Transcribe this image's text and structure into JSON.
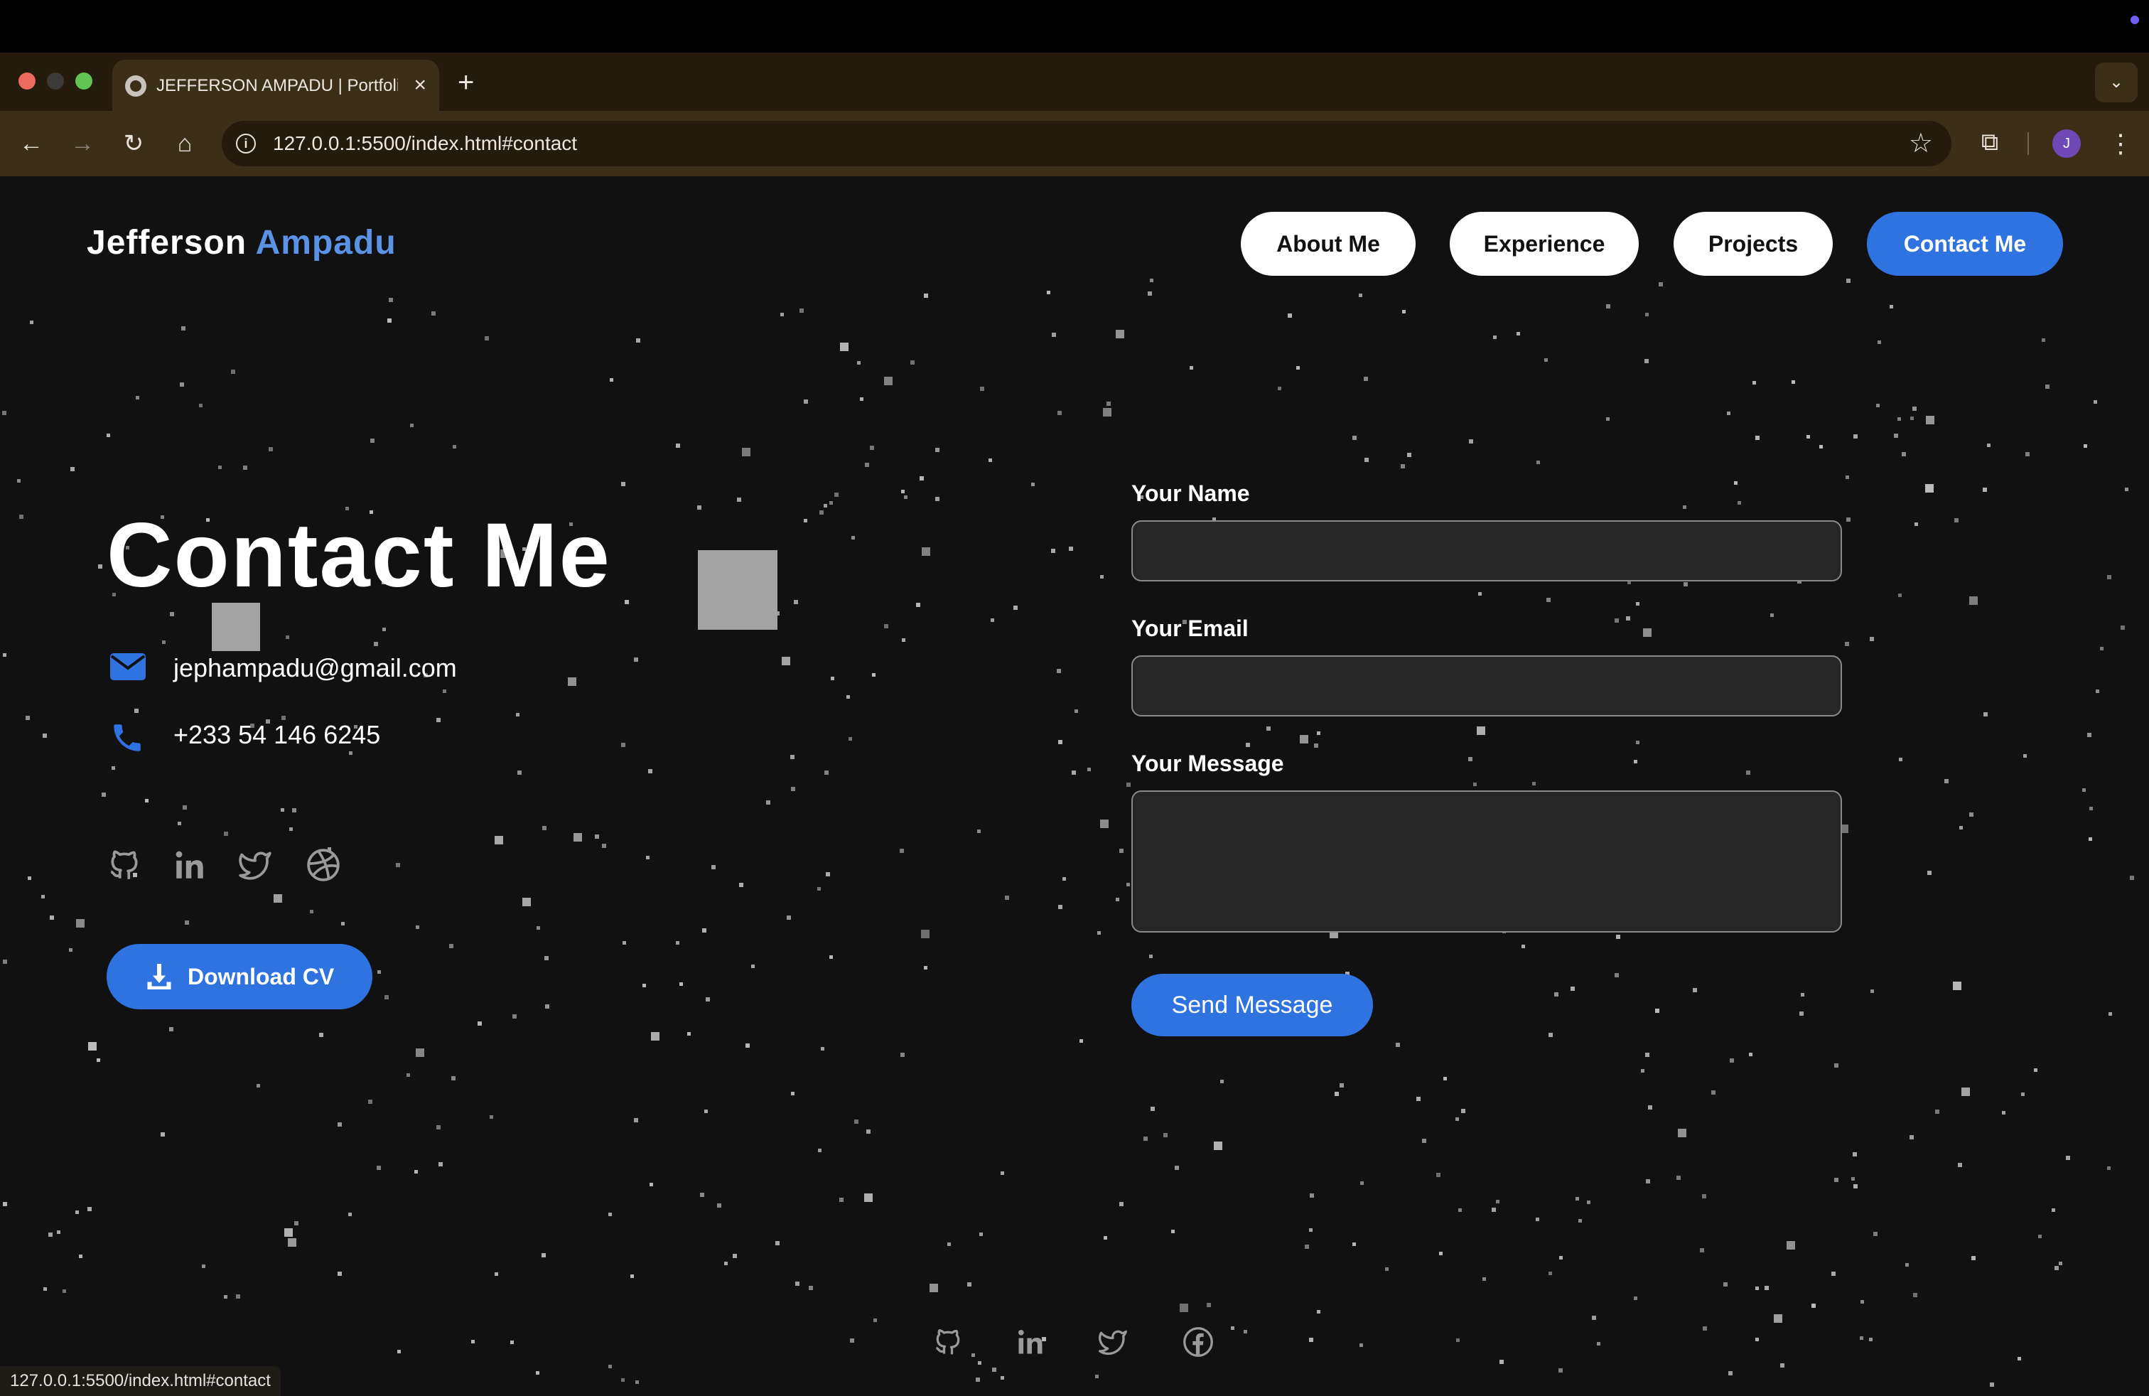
{
  "browser": {
    "tab_title": "JEFFERSON AMPADU | Portfolio",
    "tab_close": "×",
    "new_tab": "+",
    "tab_menu": "⌄",
    "url": "127.0.0.1:5500/index.html#contact",
    "profile_initial": "J",
    "status_url": "127.0.0.1:5500/index.html#contact",
    "icons": [
      "back-icon",
      "forward-icon",
      "reload-icon",
      "home-icon",
      "info-icon",
      "bookmark-star-icon",
      "extensions-icon",
      "menu-kebab-icon"
    ]
  },
  "header": {
    "logo_first": "Jefferson",
    "logo_last": "Ampadu",
    "nav": {
      "about": "About Me",
      "experience": "Experience",
      "projects": "Projects",
      "contact": "Contact Me"
    }
  },
  "contact": {
    "heading": "Contact Me",
    "email": "jephampadu@gmail.com",
    "phone": "+233 54 146 6245",
    "social_icons": [
      "github-icon",
      "linkedin-icon",
      "twitter-icon",
      "dribbble-icon"
    ],
    "cv_button": "Download CV"
  },
  "form": {
    "name_label": "Your Name",
    "name_value": "",
    "email_label": "Your Email",
    "email_value": "",
    "message_label": "Your Message",
    "message_value": "",
    "submit": "Send Message"
  },
  "footer": {
    "social_icons": [
      "github-icon",
      "linkedin-icon",
      "twitter-icon",
      "facebook-icon"
    ]
  },
  "colors": {
    "accent": "#2f73e0",
    "logo_accent": "#5a93e6",
    "page_bg": "#111112",
    "chrome_bg": "#3b2f18"
  }
}
